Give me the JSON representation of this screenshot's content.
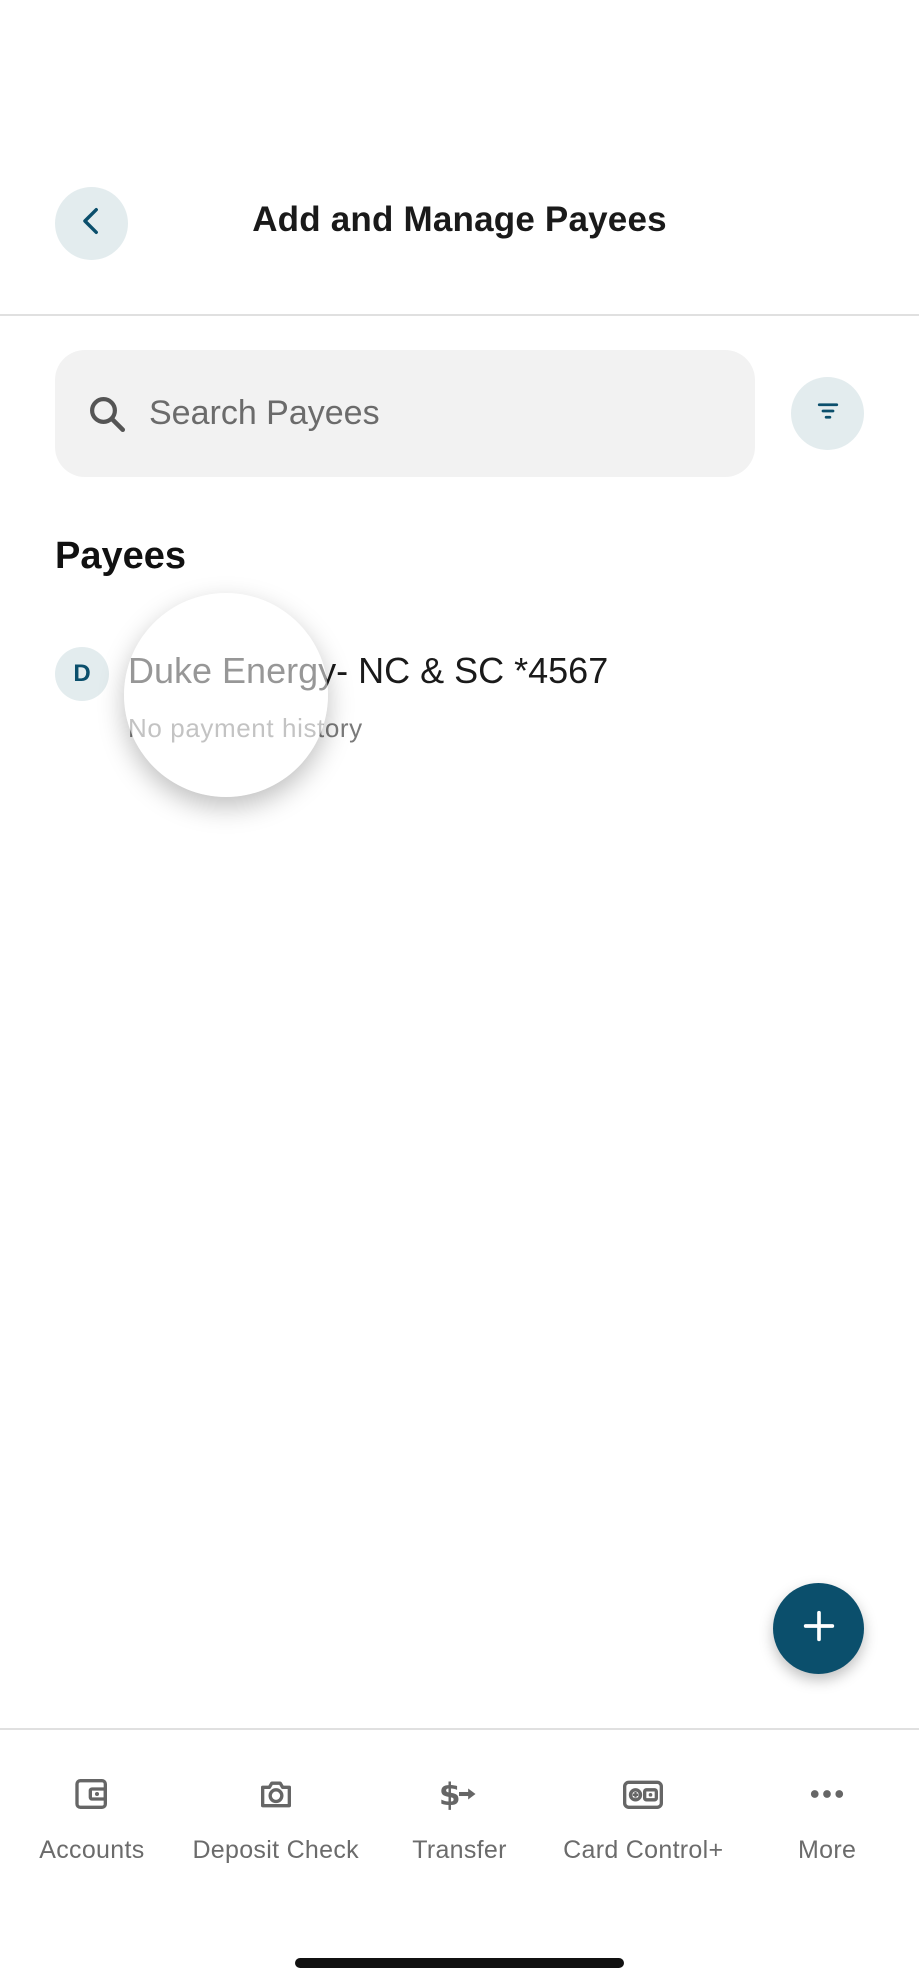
{
  "header": {
    "title": "Add and Manage Payees",
    "back_icon": "chevron-left-icon"
  },
  "search": {
    "placeholder": "Search Payees",
    "value": "",
    "icon": "search-icon"
  },
  "filter": {
    "icon": "filter-icon"
  },
  "payees_section": {
    "title": "Payees",
    "items": [
      {
        "initial": "D",
        "name": "Duke Energy- NC & SC *4567",
        "subtitle": "No payment history"
      }
    ]
  },
  "fab": {
    "icon": "plus-icon"
  },
  "bottom_nav": {
    "items": [
      {
        "label": "Accounts",
        "icon": "wallet-icon"
      },
      {
        "label": "Deposit Check",
        "icon": "camera-icon"
      },
      {
        "label": "Transfer",
        "icon": "dollar-transfer-icon"
      },
      {
        "label": "Card Control+",
        "icon": "card-control-icon"
      },
      {
        "label": "More",
        "icon": "more-dots-icon"
      }
    ]
  },
  "colors": {
    "accent": "#0b4f6c",
    "icon_bg": "#e3ecee",
    "search_bg": "#f2f2f2",
    "nav_gray": "#6b6b6b"
  }
}
